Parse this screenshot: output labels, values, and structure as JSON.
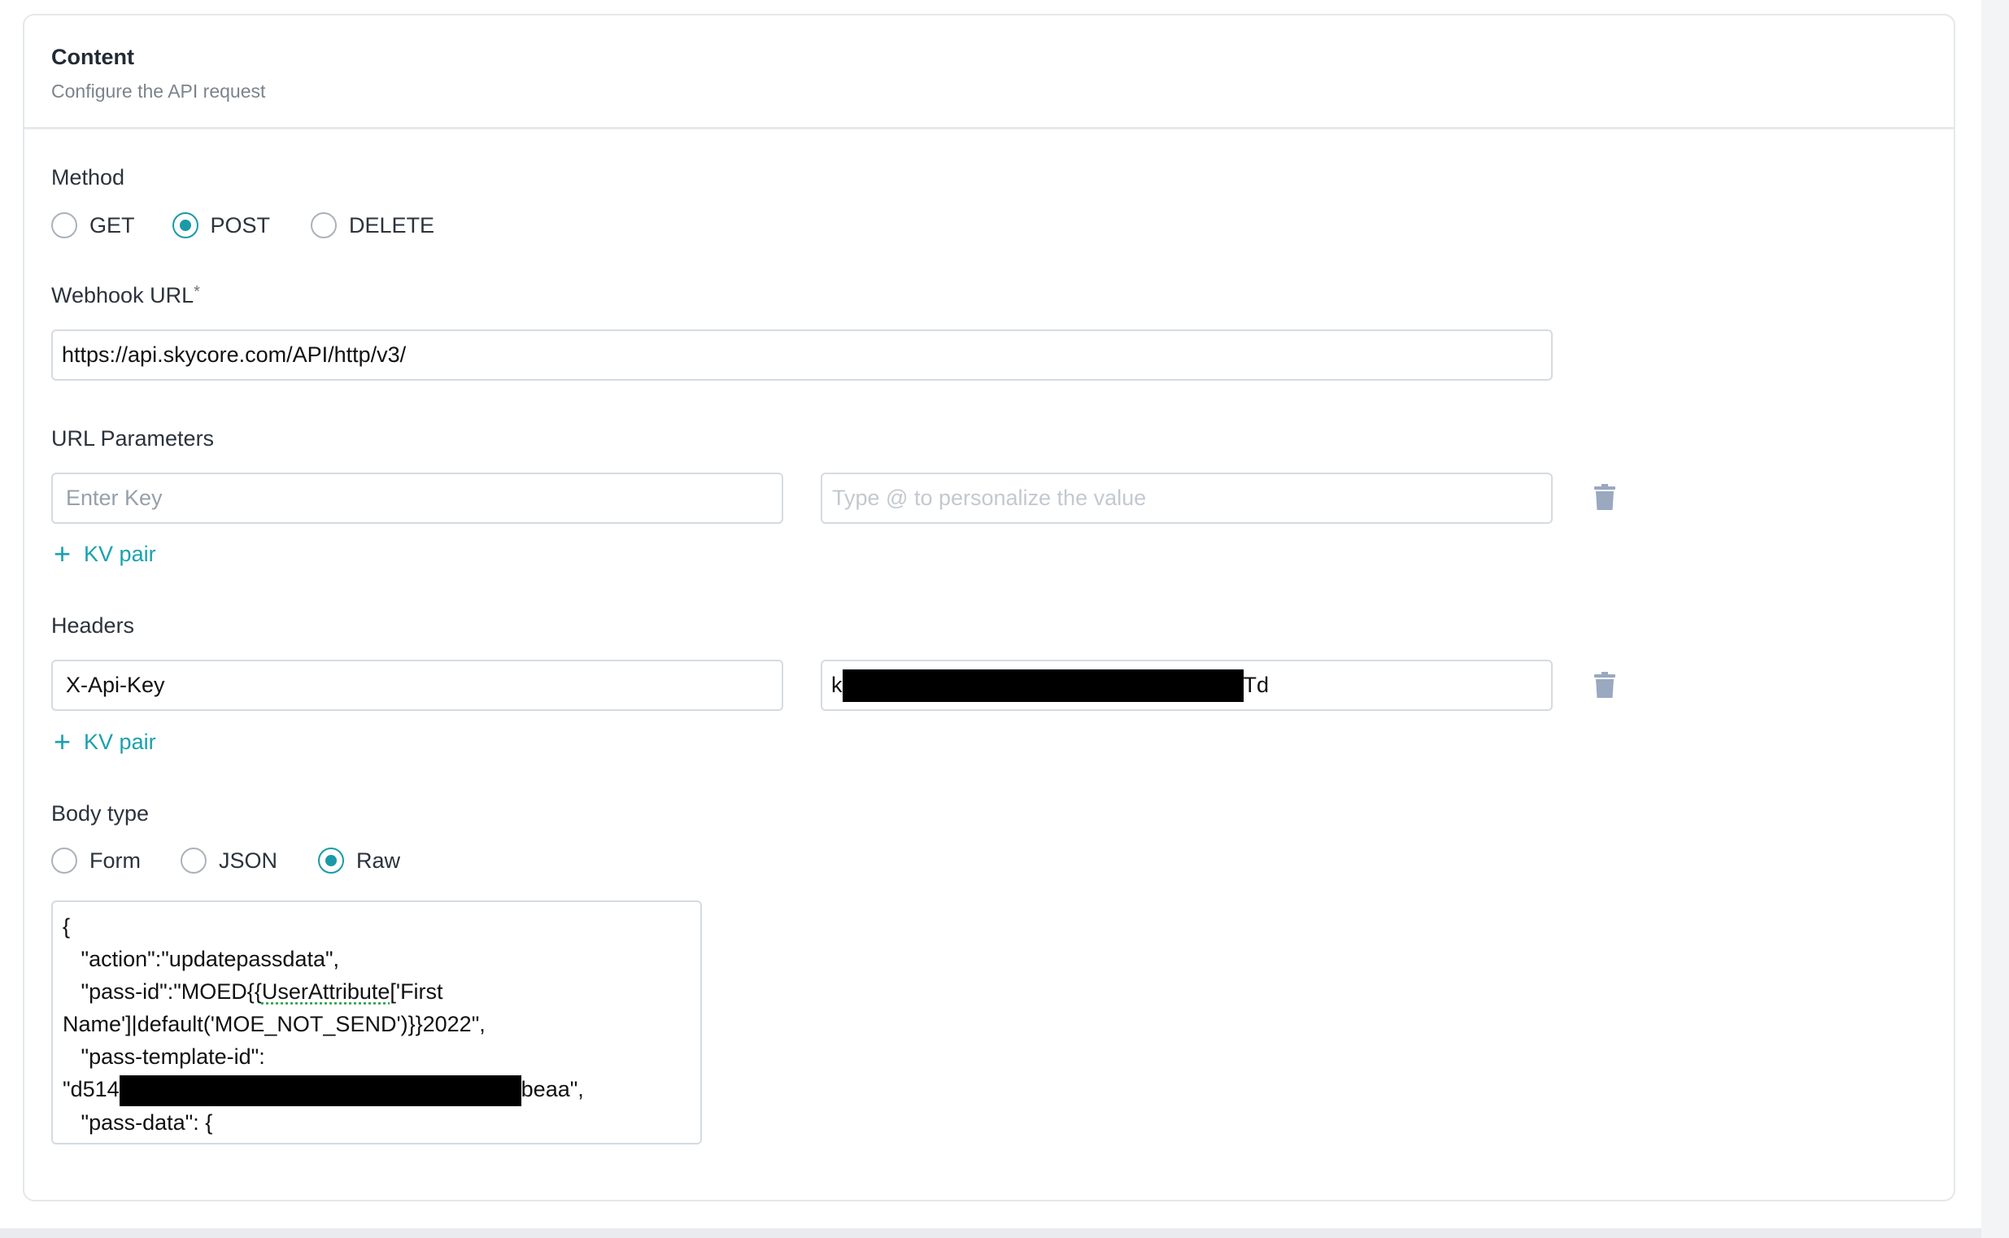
{
  "card": {
    "title": "Content",
    "subtitle": "Configure the API request"
  },
  "method": {
    "label": "Method",
    "options": [
      "GET",
      "POST",
      "DELETE"
    ],
    "selected": "POST"
  },
  "webhook": {
    "label": "Webhook URL",
    "required_mark": "*",
    "value": "https://api.skycore.com/API/http/v3/"
  },
  "url_params": {
    "label": "URL Parameters",
    "key_placeholder": "Enter Key",
    "value_placeholder": "Type @ to personalize the value",
    "add_label": "KV pair"
  },
  "headers": {
    "label": "Headers",
    "key_value": "X-Api-Key",
    "value_prefix": "k",
    "value_suffix": "Td",
    "add_label": "KV pair"
  },
  "body_type": {
    "label": "Body type",
    "options": [
      "Form",
      "JSON",
      "Raw"
    ],
    "selected": "Raw"
  },
  "body": {
    "line1": "{",
    "line2": "   \"action\":\"updatepassdata\",",
    "line3_pre": "   \"pass-id\":\"MOED{{",
    "line3_mark": "UserAttribute",
    "line3_post": "['First",
    "line4": "Name']|default('MOE_NOT_SEND')}}2022\",",
    "line5": "   \"pass-template-id\":",
    "line6_prefix": "\"d514",
    "line6_suffix": "beaa\",",
    "line7": "   \"pass-data\": {"
  },
  "colors": {
    "accent": "#1a9aa6",
    "trash": "#9aa8c0"
  }
}
